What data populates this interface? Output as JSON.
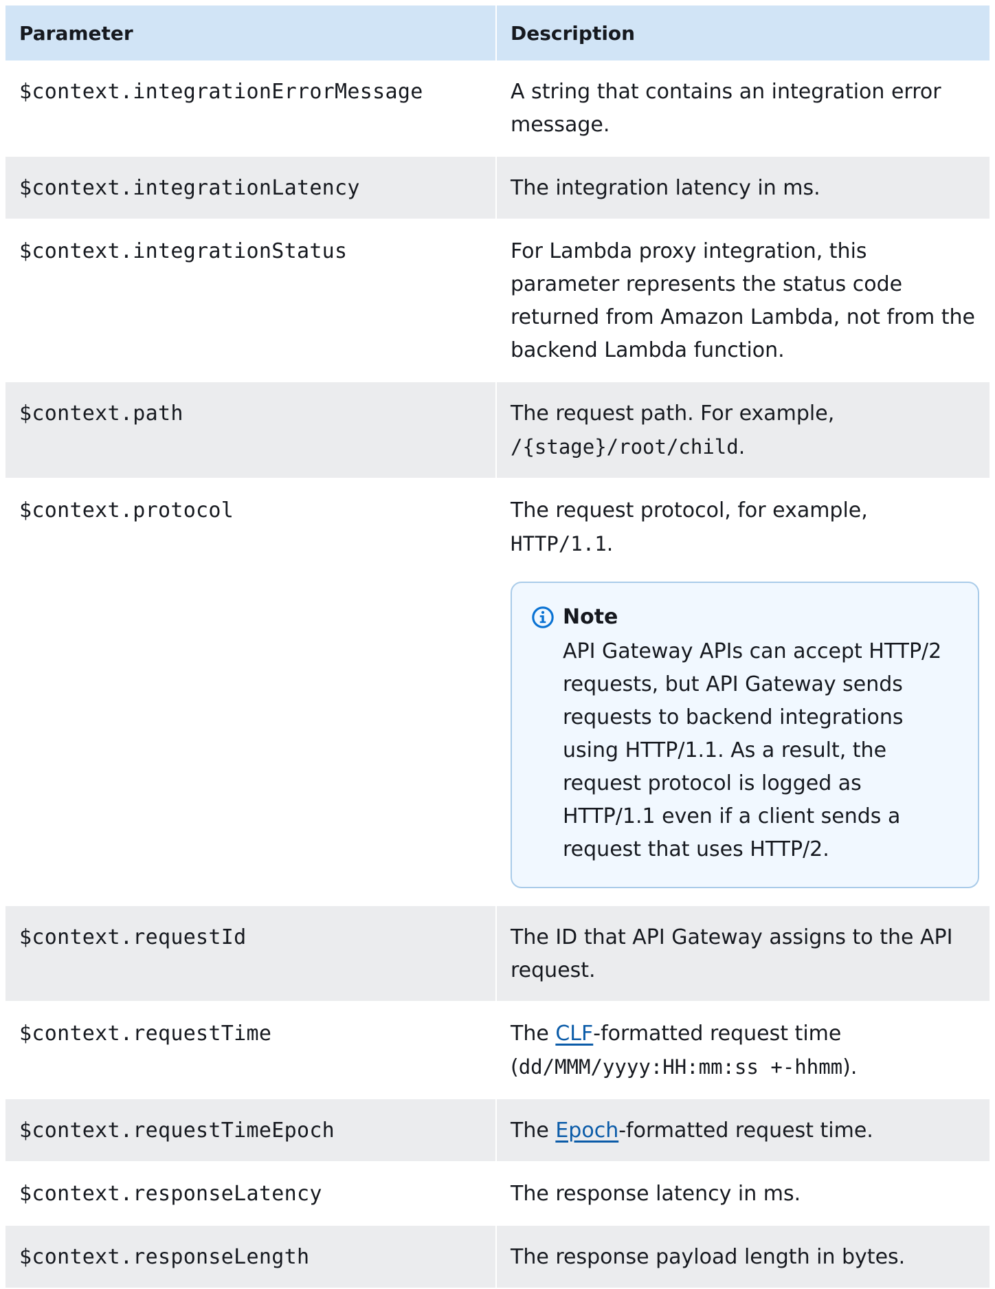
{
  "header": {
    "parameter": "Parameter",
    "description": "Description"
  },
  "rows": [
    {
      "param": "$context.integrationErrorMessage",
      "desc": "A string that contains an integration error message."
    },
    {
      "param": "$context.integrationLatency",
      "desc": "The integration latency in ms."
    },
    {
      "param": "$context.integrationStatus",
      "desc": "For Lambda proxy integration, this parameter represents the status code returned from Amazon Lambda, not from the backend Lambda function."
    },
    {
      "param": "$context.path",
      "desc_pre": "The request path. For example, ",
      "desc_code": "/{stage}/root/child",
      "desc_post": "."
    },
    {
      "param": "$context.protocol",
      "desc_pre": "The request protocol, for example, ",
      "desc_code": "HTTP/1.1",
      "desc_post": ".",
      "note": {
        "title": "Note",
        "icon": "info-icon",
        "body": "API Gateway APIs can accept HTTP/2 requests, but API Gateway sends requests to backend integrations using HTTP/1.1. As a result, the request protocol is logged as HTTP/1.1 even if a client sends a request that uses HTTP/2."
      }
    },
    {
      "param": "$context.requestId",
      "desc": "The ID that API Gateway assigns to the API request."
    },
    {
      "param": "$context.requestTime",
      "desc_pre": "The ",
      "desc_link": "CLF",
      "desc_mid": "-formatted request time (",
      "desc_code": "dd/MMM/yyyy:HH:mm:ss +-hhmm",
      "desc_post": ")."
    },
    {
      "param": "$context.requestTimeEpoch",
      "desc_pre": "The ",
      "desc_link": "Epoch",
      "desc_post": "-formatted request time."
    },
    {
      "param": "$context.responseLatency",
      "desc": "The response latency in ms."
    },
    {
      "param": "$context.responseLength",
      "desc": "The response payload length in bytes."
    }
  ],
  "colors": {
    "header_bg": "#d1e4f6",
    "stripe_bg": "#ebecee",
    "link": "#0a5ba8",
    "note_border": "#a9cbe9",
    "note_bg": "#f1f8ff",
    "info_icon": "#0972d3"
  }
}
